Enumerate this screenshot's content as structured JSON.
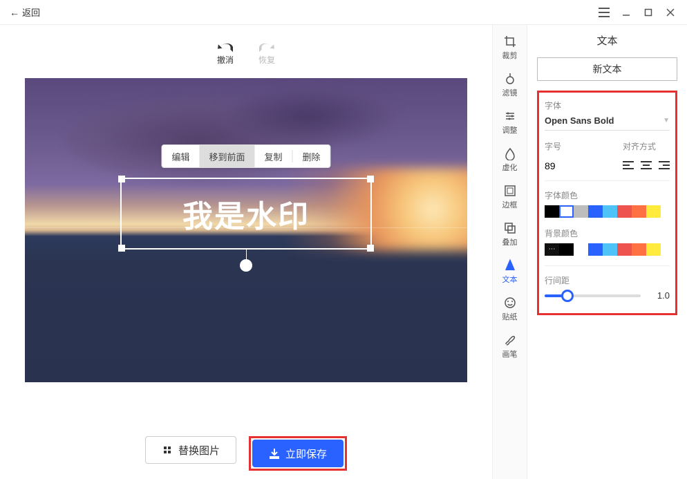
{
  "titlebar": {
    "back": "返回"
  },
  "undoRedo": {
    "undo": "撤消",
    "redo": "恢复"
  },
  "ctx": {
    "edit": "编辑",
    "front": "移到前面",
    "copy": "复制",
    "delete": "删除"
  },
  "watermark": {
    "text": "我是水印"
  },
  "bottom": {
    "replace": "替换图片",
    "save": "立即保存"
  },
  "tools": {
    "crop": "裁剪",
    "filter": "滤镜",
    "adjust": "调整",
    "blur": "虚化",
    "border": "边框",
    "overlay": "叠加",
    "text": "文本",
    "sticker": "贴纸",
    "brush": "画笔"
  },
  "panel": {
    "title": "文本",
    "newText": "新文本",
    "fontLabel": "字体",
    "fontName": "Open Sans Bold",
    "sizeLabel": "字号",
    "sizeValue": "89",
    "alignLabel": "对齐方式",
    "textColorLabel": "字体颜色",
    "bgColorLabel": "背景颜色",
    "lineHeightLabel": "行间距",
    "lineHeightValue": "1.0",
    "textColors": [
      "#000000",
      "selected-white",
      "#bdbdbd",
      "#2962ff",
      "#4fc3f7",
      "#ef5350",
      "#ff7043",
      "#ffeb3b"
    ],
    "bgColors": [
      "more",
      "#000000",
      "spacer",
      "#2962ff",
      "#4fc3f7",
      "#ef5350",
      "#ff7043",
      "#ffeb3b"
    ]
  }
}
